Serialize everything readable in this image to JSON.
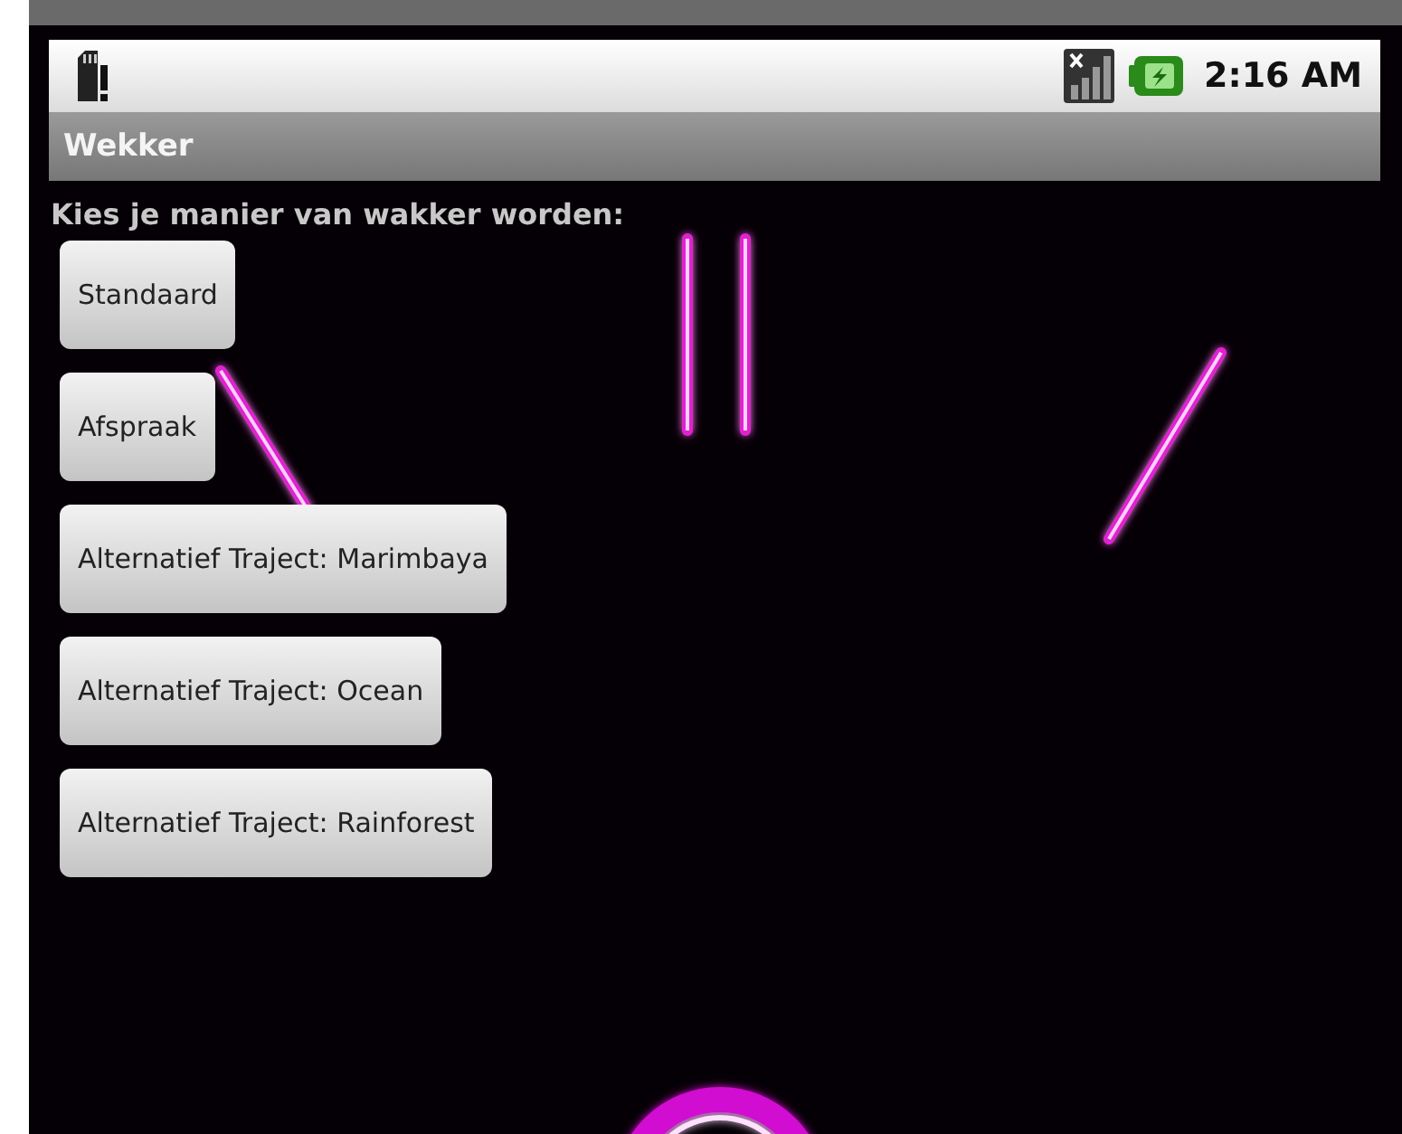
{
  "status_bar": {
    "time": "2:16 AM"
  },
  "window": {
    "title": "Wekker"
  },
  "prompt": "Kies je manier van wakker worden:",
  "buttons": [
    {
      "label": "Standaard"
    },
    {
      "label": "Afspraak"
    },
    {
      "label": "Alternatief Traject: Marimbaya"
    },
    {
      "label": "Alternatief Traject: Ocean"
    },
    {
      "label": "Alternatief Traject: Rainforest"
    }
  ]
}
